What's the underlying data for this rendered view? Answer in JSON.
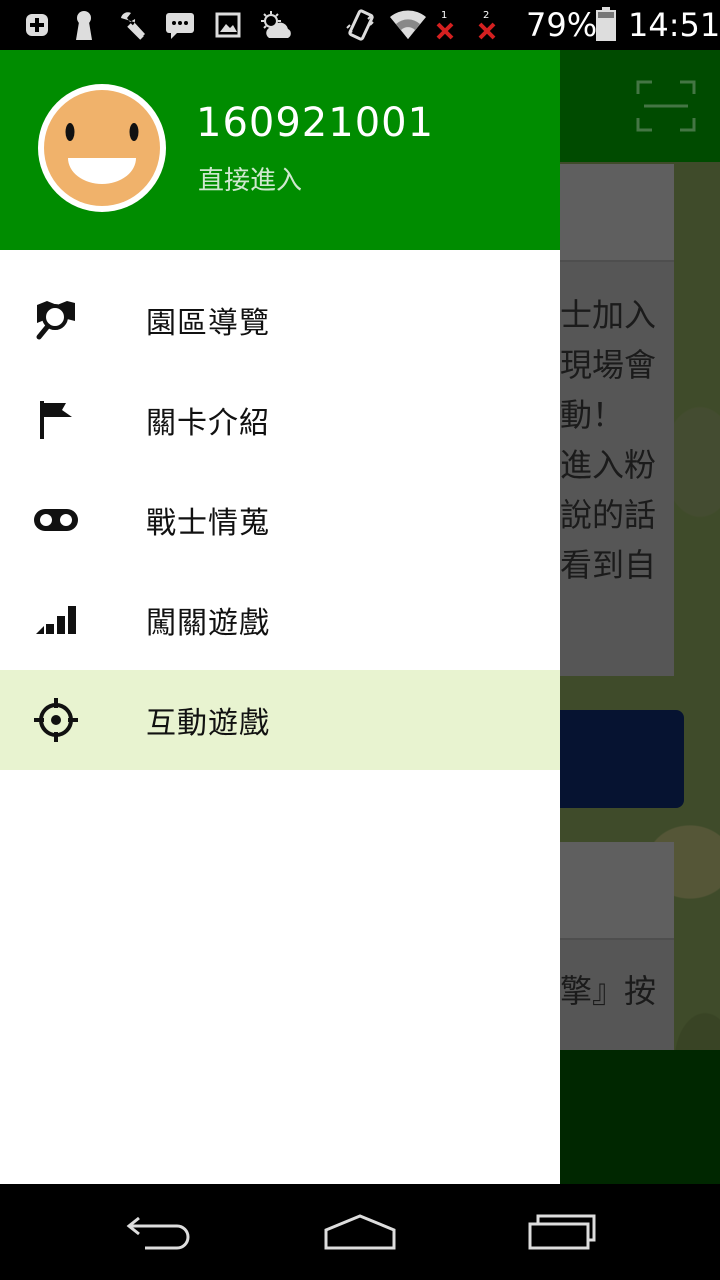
{
  "status_bar": {
    "battery_percent": "79%",
    "time": "14:51",
    "sim1_label": "1",
    "sim2_label": "2",
    "icons": [
      "add-icon",
      "keyhole-icon",
      "wrench-icon",
      "message-icon",
      "image-icon",
      "weather-icon",
      "vibrate-icon",
      "wifi-icon",
      "sim1-no-signal-icon",
      "sim2-no-signal-icon",
      "battery-icon"
    ]
  },
  "background_app": {
    "text_lines": [
      "士加入",
      "現場會",
      "動！",
      "進入粉",
      "說的話",
      "看到自"
    ],
    "bottom_card_text": "擎』按",
    "scan_icon": "scan-icon"
  },
  "drawer": {
    "user": {
      "name": "160921001",
      "subtitle": "直接進入",
      "avatar_icon": "smiley-avatar-icon"
    },
    "items": [
      {
        "label": "園區導覽",
        "icon": "map-search-icon",
        "active": false
      },
      {
        "label": "關卡介紹",
        "icon": "flag-icon",
        "active": false
      },
      {
        "label": "戰士情蒐",
        "icon": "binoculars-icon",
        "active": false
      },
      {
        "label": "闖關遊戲",
        "icon": "signal-bars-icon",
        "active": false
      },
      {
        "label": "互動遊戲",
        "icon": "crosshair-icon",
        "active": true
      }
    ]
  },
  "nav_bar": {
    "buttons": [
      "back-icon",
      "home-icon",
      "recents-icon"
    ]
  },
  "colors": {
    "drawer_header": "#008c00",
    "active_item_bg": "#e8f3d0",
    "toolbar": "#007a00"
  }
}
